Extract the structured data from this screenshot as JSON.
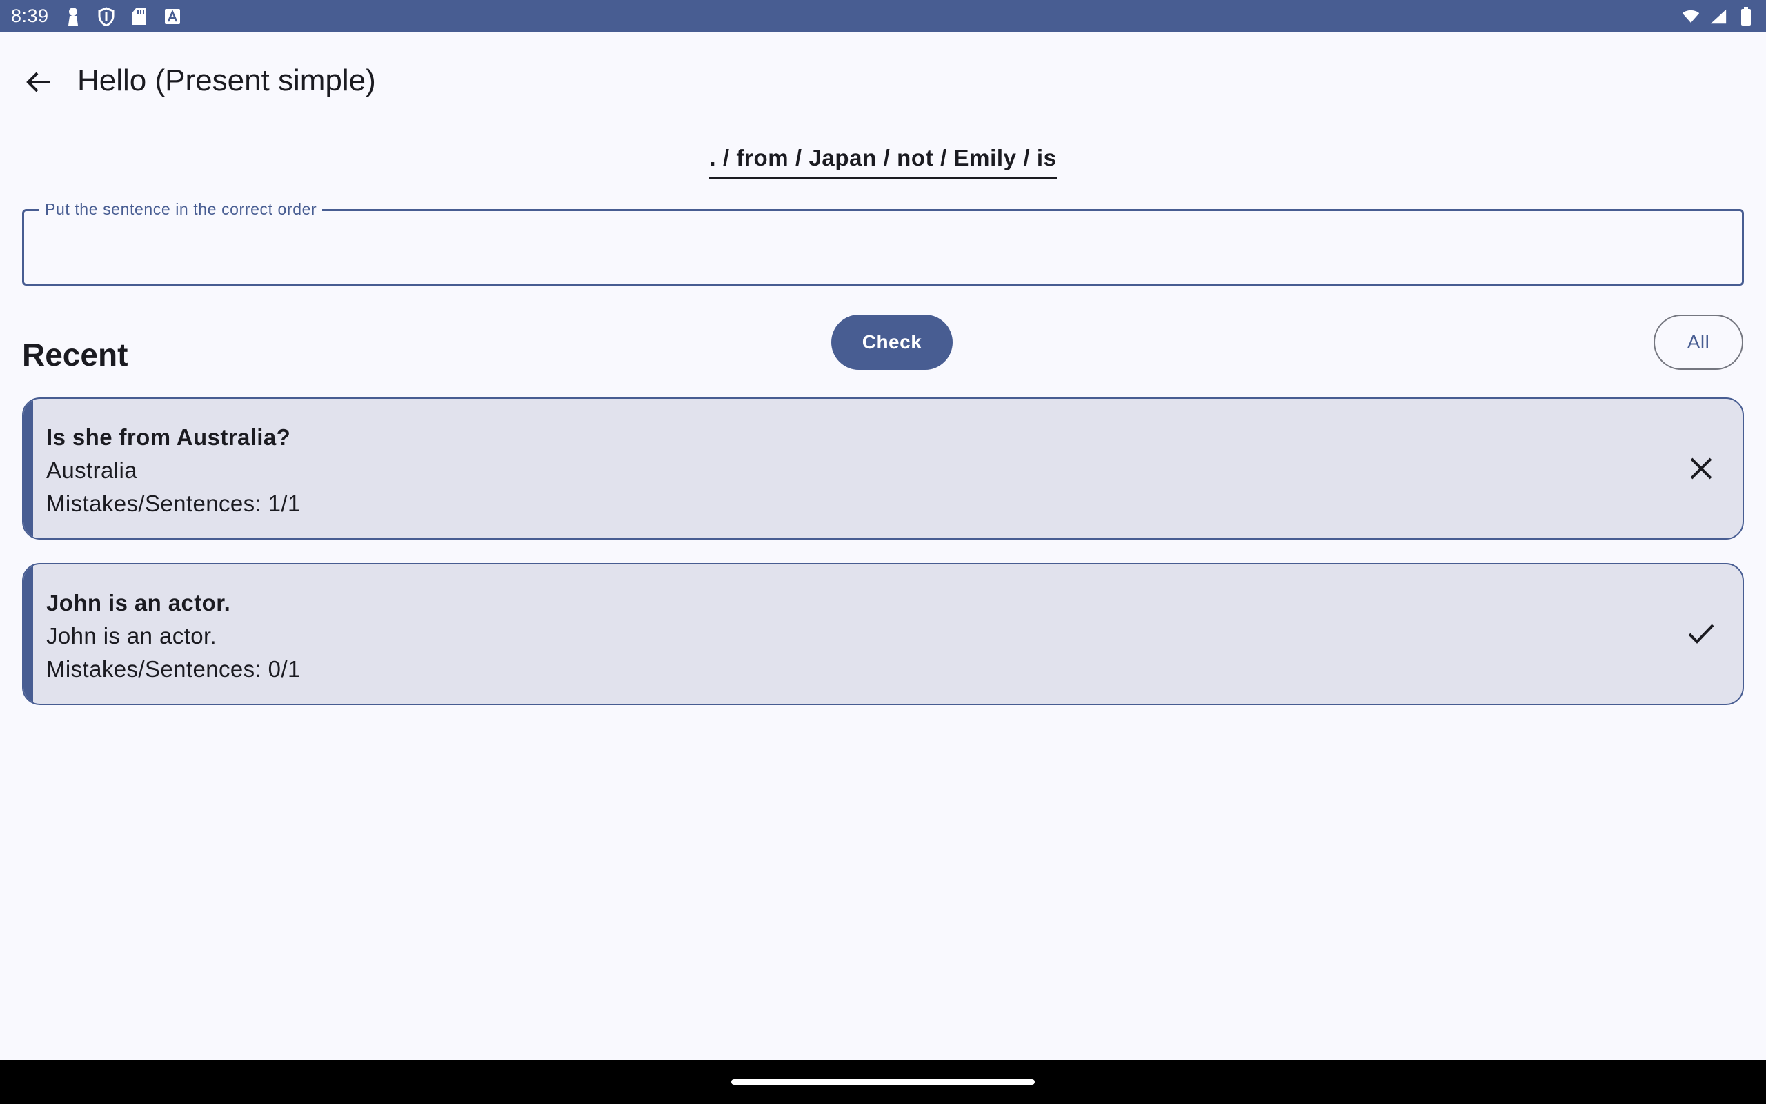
{
  "status_bar": {
    "time": "8:39",
    "left_icons": [
      "person-icon",
      "shield-icon",
      "sd-card-icon",
      "font-icon"
    ],
    "right_icons": [
      "wifi-icon",
      "signal-icon",
      "battery-icon"
    ]
  },
  "app_bar": {
    "title": "Hello (Present simple)",
    "back_icon": "arrow-back-icon"
  },
  "exercise": {
    "words": ". / from / Japan / not / Emily / is",
    "input_label": "Put the sentence in the correct order",
    "input_value": ""
  },
  "actions": {
    "check_label": "Check",
    "all_label": "All"
  },
  "recent": {
    "title": "Recent",
    "items": [
      {
        "sentence": "Is she from Australia?",
        "answer": "Australia",
        "stats": "Mistakes/Sentences: 1/1",
        "status_icon": "close-icon"
      },
      {
        "sentence": "John is an actor.",
        "answer": "John is an actor.",
        "stats": "Mistakes/Sentences: 0/1",
        "status_icon": "check-icon"
      }
    ]
  },
  "colors": {
    "primary": "#485d92",
    "background": "#f9f9fe",
    "card": "#e1e2ed",
    "on_surface": "#1b1b21"
  }
}
